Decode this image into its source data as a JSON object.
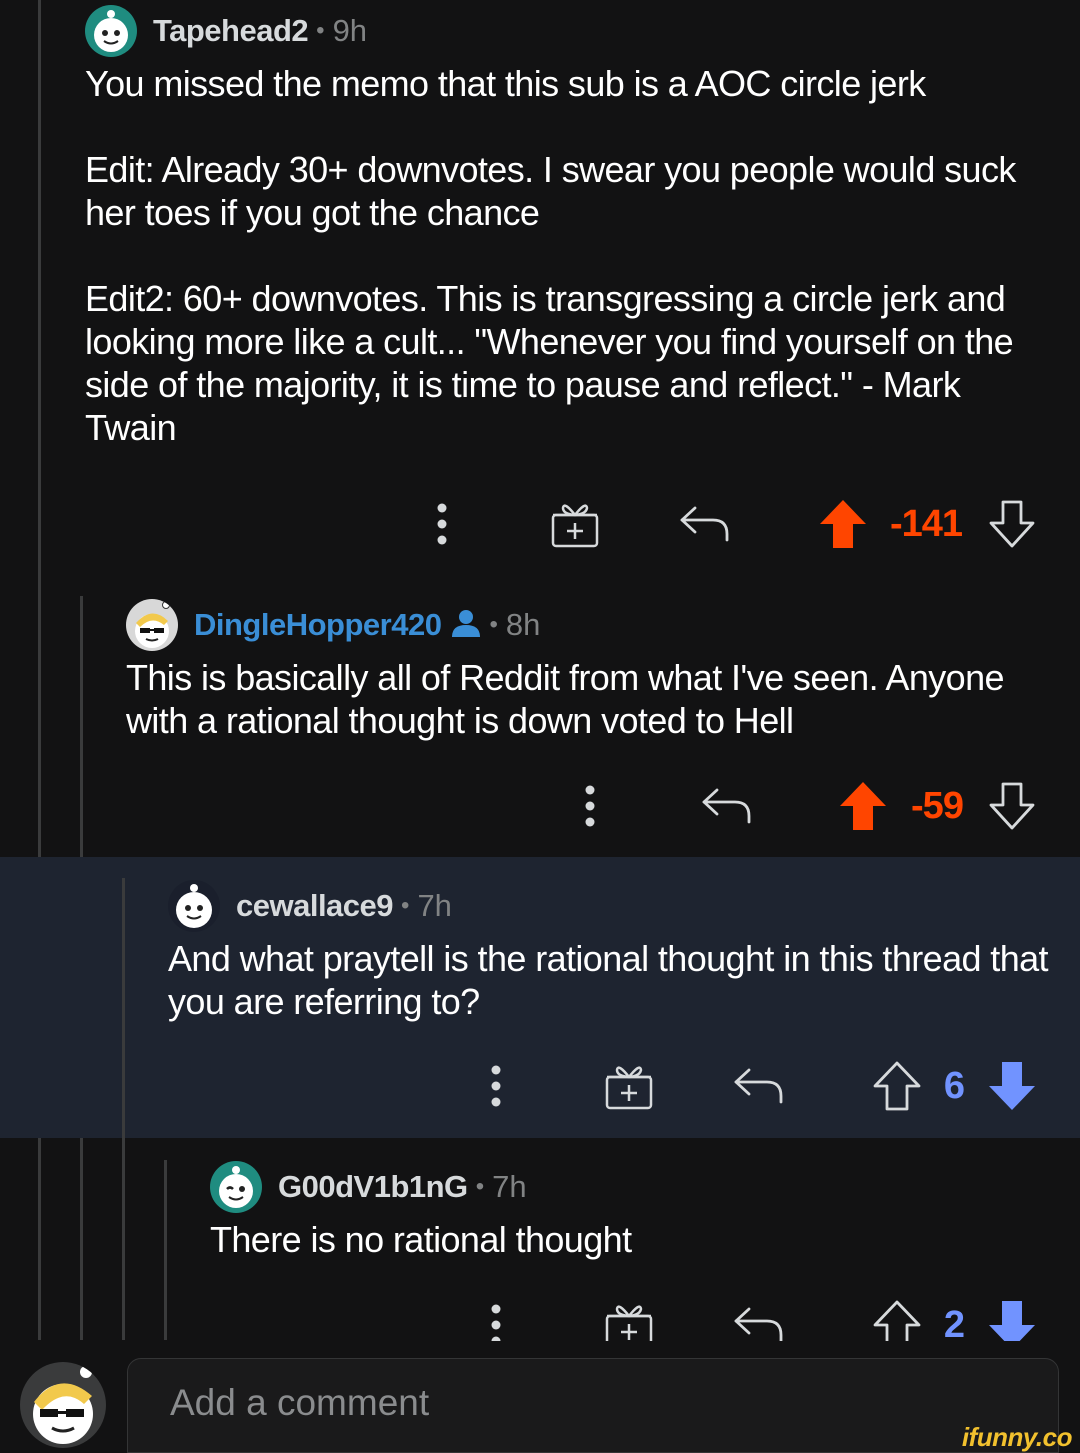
{
  "comments": [
    {
      "username": "Tapehead2",
      "time": "9h",
      "body": [
        "You missed the memo that this sub is a AOC circle jerk",
        "Edit: Already 30+ downvotes. I swear you people would suck her toes if you got the chance",
        "Edit2: 60+ downvotes. This is transgressing a circle jerk and looking more like a cult... \"Whenever you find yourself on the side of the majority, it is time to pause and reflect.\" - Mark Twain"
      ],
      "score": "-141",
      "vote": "up"
    },
    {
      "username": "DingleHopper420",
      "time": "8h",
      "body": [
        "This is basically all of Reddit from what I've seen. Anyone with a rational thought is down voted to Hell"
      ],
      "score": "-59",
      "vote": "up"
    },
    {
      "username": "cewallace9",
      "time": "7h",
      "body": [
        "And what praytell is the rational thought in this thread that you are referring to?"
      ],
      "score": "6",
      "vote": "down"
    },
    {
      "username": "G00dV1b1nG",
      "time": "7h",
      "body": [
        "There is no rational thought"
      ],
      "score": "2",
      "vote": "down"
    }
  ],
  "separator": "•",
  "composer": {
    "placeholder": "Add a comment"
  },
  "watermark": "ifunny.co",
  "icons": {
    "more": "more-vertical-icon",
    "award": "gift-award-icon",
    "reply": "reply-arrow-icon",
    "upvote": "upvote-arrow-icon",
    "downvote": "downvote-arrow-icon"
  },
  "colors": {
    "upvote_active": "#ff4500",
    "downvote_active": "#7193ff",
    "username_highlight": "#3a8ed6",
    "background": "#121213",
    "highlight_background": "#1e2430"
  }
}
